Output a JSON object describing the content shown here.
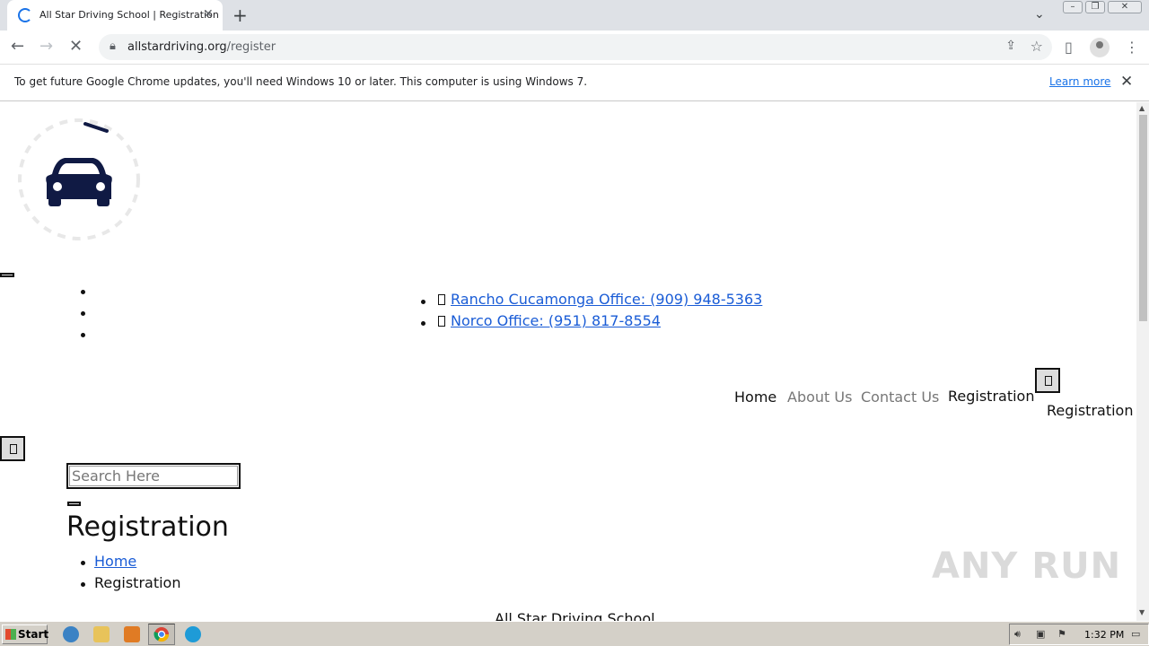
{
  "browser": {
    "tab_title": "All Star Driving School | Registration",
    "new_tab_label": "+",
    "url_domain": "allstardriving.org",
    "url_path": "/register",
    "infobar_message": "To get future Google Chrome updates, you'll need Windows 10 or later. This computer is using Windows 7.",
    "learn_more": "Learn more"
  },
  "page": {
    "offices": [
      {
        "label": "Rancho Cucamonga Office: (909) 948-5363"
      },
      {
        "label": "Norco Office: (951) 817-8554"
      }
    ],
    "nav": {
      "home": "Home",
      "about": "About Us",
      "contact": "Contact Us",
      "registration": "Registration",
      "registration_secondary": "Registration"
    },
    "search": {
      "placeholder": "Search Here"
    },
    "title": "Registration",
    "breadcrumb": {
      "home": "Home",
      "current": "Registration"
    },
    "footer_school": "All Star Driving School"
  },
  "watermark": "ANY RUN",
  "taskbar": {
    "start_label": "Start",
    "clock": "1:32 PM"
  },
  "colors": {
    "link": "#1a5cd6",
    "logo_navy": "#101a44",
    "chrome_accent": "#1a73e8"
  }
}
